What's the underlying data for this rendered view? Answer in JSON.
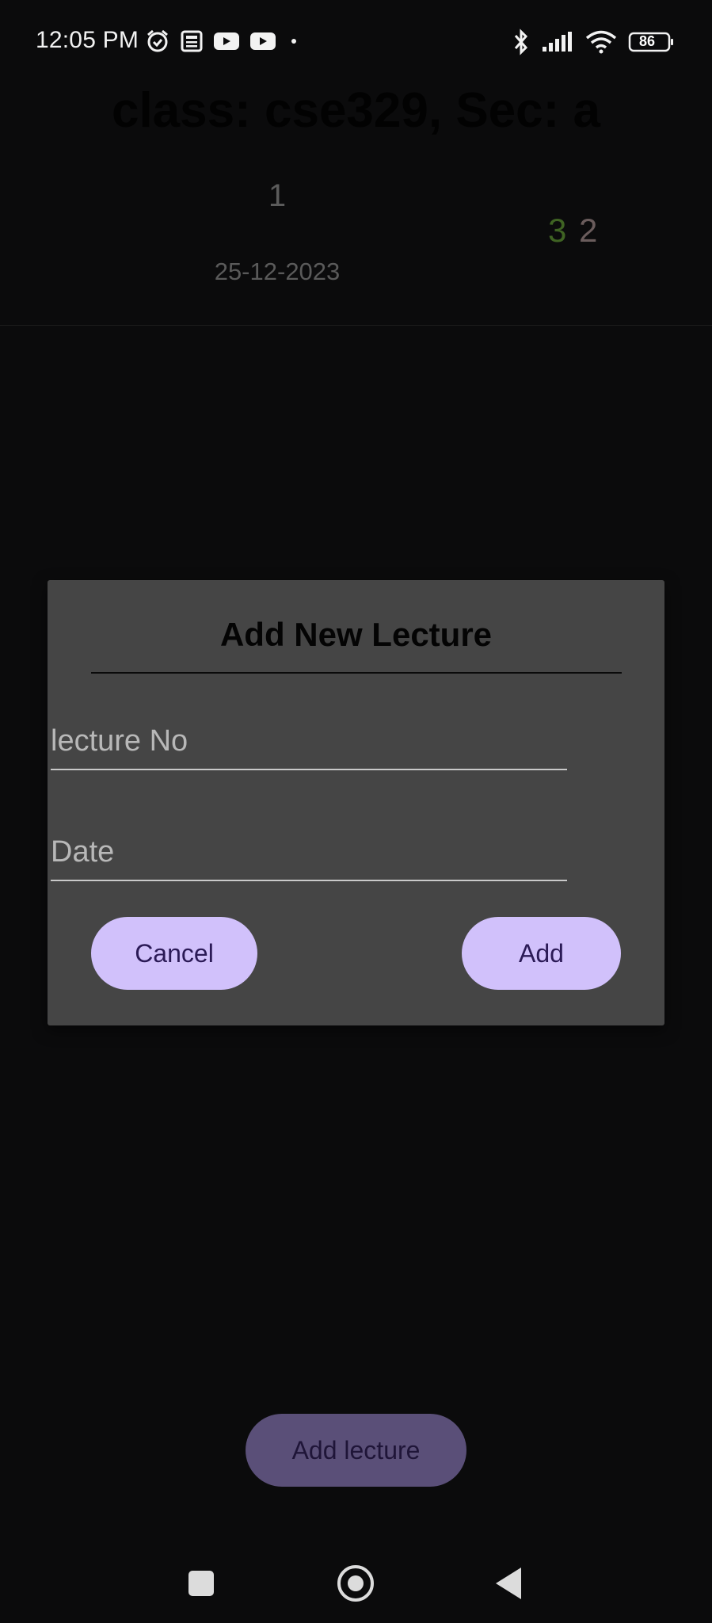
{
  "status_bar": {
    "time": "12:05 PM",
    "left_icons": [
      "alarm-icon",
      "news-icon",
      "youtube-icon",
      "youtube-icon",
      "dot-icon"
    ],
    "right_icons": [
      "bluetooth-icon",
      "signal-icon",
      "wifi-icon",
      "battery-icon"
    ],
    "battery_level": "86"
  },
  "header": {
    "class_title": "class: cse329, Sec: a"
  },
  "lectures": [
    {
      "number": "1",
      "date": "25-12-2023",
      "present_count": "3",
      "absent_count": "2"
    }
  ],
  "dialog": {
    "title": "Add New Lecture",
    "lecture_no_placeholder": "lecture No",
    "date_placeholder": "Date",
    "cancel_label": "Cancel",
    "add_label": "Add"
  },
  "main": {
    "add_lecture_label": "Add lecture"
  },
  "colors": {
    "accent": "#d1c1fb",
    "accent_text": "#2b1a56",
    "present": "#3f6323",
    "absent": "#6a5c5c",
    "dialog_bg": "#454545"
  }
}
